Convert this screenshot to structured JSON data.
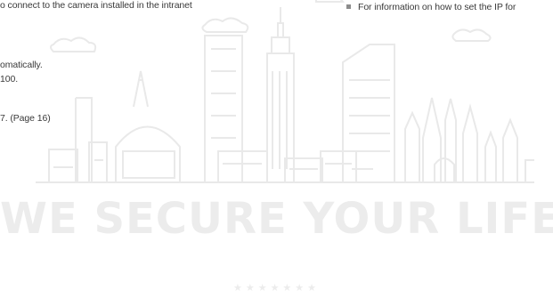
{
  "left_column": {
    "line_1": "o connect to the camera installed in the intranet",
    "line_2": "omatically.",
    "line_3": "100.",
    "line_4": "7. (Page 16)"
  },
  "right_column": {
    "bullet_text": "For information on how to set the IP for"
  },
  "watermark": {
    "tagline": "WE SECURE YOUR LIFE",
    "stars": "★★★★★★★",
    "color": "#ececec"
  }
}
